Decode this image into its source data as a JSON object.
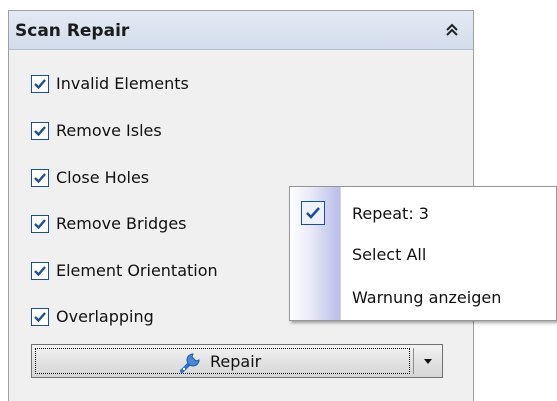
{
  "panel": {
    "title": "Scan Repair",
    "collapse_icon": "double-chevron-up-icon",
    "options": [
      {
        "label": "Invalid Elements",
        "checked": true
      },
      {
        "label": "Remove Isles",
        "checked": true
      },
      {
        "label": "Close Holes",
        "checked": true
      },
      {
        "label": "Remove Bridges",
        "checked": true
      },
      {
        "label": "Element Orientation",
        "checked": true
      },
      {
        "label": "Overlapping",
        "checked": true
      }
    ],
    "repair_button": {
      "label": "Repair",
      "icon": "wrench-icon",
      "dropdown_icon": "dropdown-arrow-icon"
    }
  },
  "context_menu": {
    "items": [
      {
        "label": "Repeat: 3",
        "checked": true
      },
      {
        "label": "Select All",
        "checked": false
      },
      {
        "label": "Warnung anzeigen",
        "checked": false
      }
    ]
  },
  "colors": {
    "checkbox_border": "#1c4f9a",
    "check_mark": "#1c4f9a",
    "header_bg": "#d9e1f0",
    "wrench": "#2f6fc9"
  }
}
